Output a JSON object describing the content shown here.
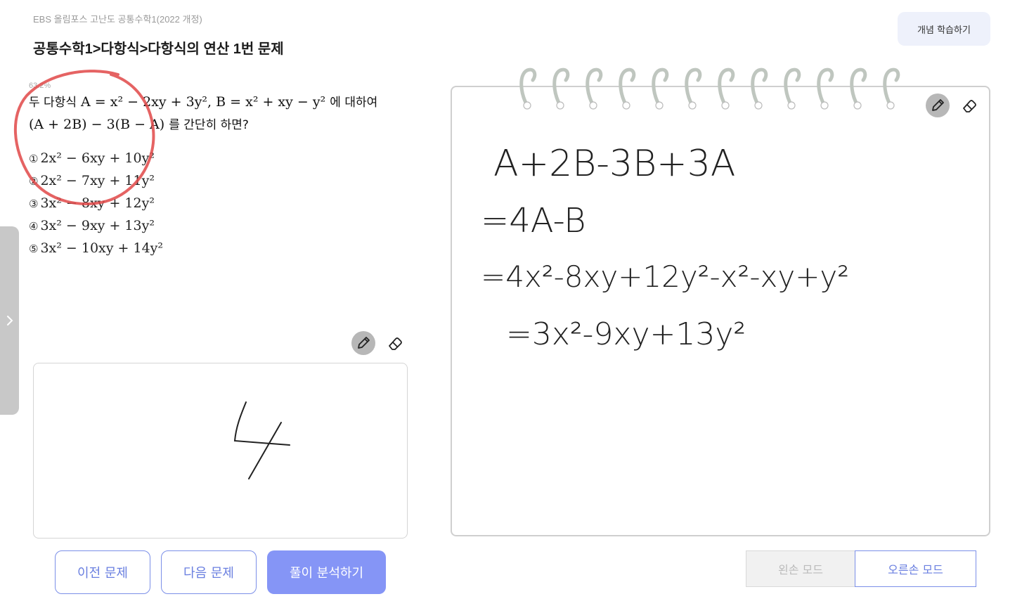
{
  "header": {
    "subtitle": "EBS 올림포스 고난도 공통수학1(2022 개정)",
    "title": "공통수학1>다항식>다항식의 연산 1번 문제",
    "concept_button": "개념 학습하기"
  },
  "problem": {
    "accuracy": "63.2%",
    "text_prefix": "두 다항식",
    "text_a_def": "A = x² − 2xy + 3y²",
    "text_b_def": "B = x² + xy − y²",
    "text_mid": "에 대하여",
    "text_expr": "(A + 2B) − 3(B − A)",
    "text_suffix": "를 간단히 하면?",
    "choices": [
      {
        "num": "①",
        "expr": "2x² − 6xy + 10y²"
      },
      {
        "num": "②",
        "expr": "2x² − 7xy + 11y²"
      },
      {
        "num": "③",
        "expr": "3x² − 8xy + 12y²"
      },
      {
        "num": "④",
        "expr": "3x² − 9xy + 13y²"
      },
      {
        "num": "⑤",
        "expr": "3x² − 10xy + 14y²"
      }
    ]
  },
  "answer_pad": {
    "handwritten_answer": "4"
  },
  "buttons": {
    "prev": "이전 문제",
    "next": "다음 문제",
    "analyze": "풀이 분석하기"
  },
  "notebook": {
    "handwriting_lines": [
      "A+2B-3B+3A",
      "=4A-B",
      "=4x²-8xy+12y²-x²-xy+y²",
      "=3x²-9xy+13y²"
    ]
  },
  "mode": {
    "left": "왼손 모드",
    "right": "오른손 모드",
    "selected": "right"
  },
  "colors": {
    "accent": "#8595f6",
    "accent_border": "#7b8fe8",
    "red_mark": "#e04848"
  }
}
